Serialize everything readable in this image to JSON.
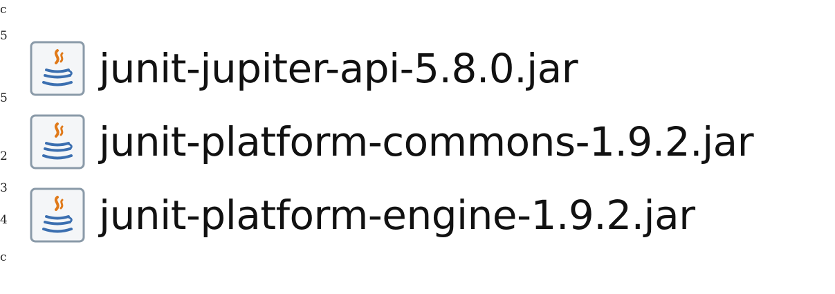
{
  "gutter": {
    "marks": [
      {
        "text": "c"
      },
      {
        "text": "5"
      },
      {
        "text": "5"
      },
      {
        "text": "2"
      },
      {
        "text": "3"
      },
      {
        "text": "4"
      },
      {
        "text": "c"
      }
    ]
  },
  "files": [
    {
      "name": "junit-jupiter-api-5.8.0.jar",
      "icon": "java-jar-icon"
    },
    {
      "name": "junit-platform-commons-1.9.2.jar",
      "icon": "java-jar-icon"
    },
    {
      "name": "junit-platform-engine-1.9.2.jar",
      "icon": "java-jar-icon"
    }
  ],
  "colors": {
    "icon_border": "#8a9aa8",
    "icon_fill": "#f4f6f8",
    "steam_orange": "#e07a1a",
    "cup_blue": "#3b6fb0",
    "text": "#111111"
  }
}
